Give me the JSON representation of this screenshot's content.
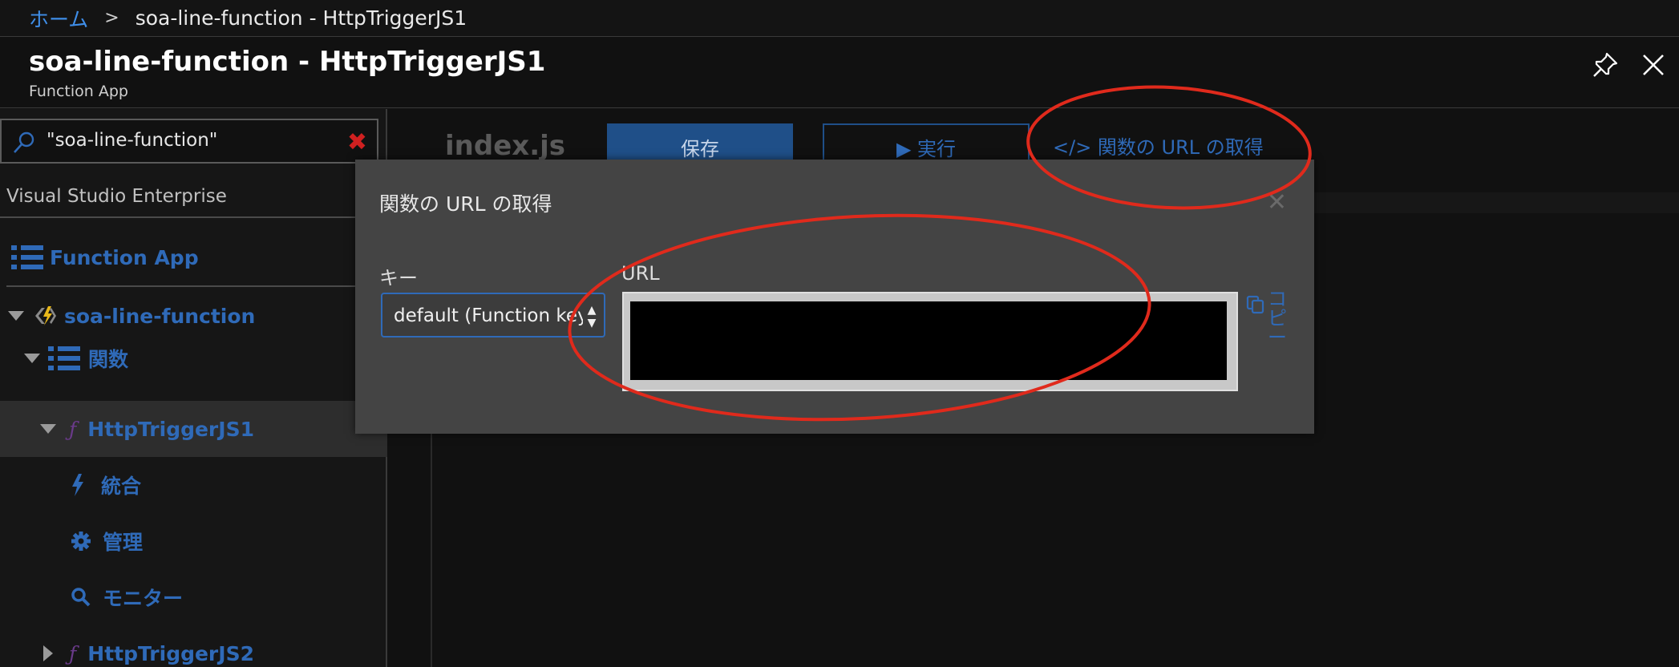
{
  "breadcrumb": {
    "home": "ホーム",
    "separator": ">",
    "current": "soa-line-function - HttpTriggerJS1"
  },
  "header": {
    "title": "soa-line-function - HttpTriggerJS1",
    "subtitle": "Function App",
    "pin_icon": "pin-icon",
    "close_icon": "close-icon"
  },
  "sidebar": {
    "search_value": "\"soa-line-function\"",
    "clear_glyph": "✖",
    "subscription": "Visual Studio Enterprise",
    "subscription_chevron": "˅",
    "function_app_label": "Function App",
    "app_name": "soa-line-function",
    "functions_label": "関数",
    "function_glyph": "ƒ",
    "selected_function": "HttpTriggerJS1",
    "integrate_label": "統合",
    "manage_label": "管理",
    "monitor_label": "モニター",
    "next_function": "HttpTriggerJS2"
  },
  "editor": {
    "file_name": "index.js",
    "save_label": "保存",
    "run_label": "▶ 実行",
    "get_url_label": "</> 関数の URL の取得"
  },
  "dialog": {
    "title": "関数の URL の取得",
    "close_glyph": "✕",
    "key_label": "キー",
    "key_value": "default (Function key)",
    "select_arrows": "▲▼",
    "url_label": "URL",
    "copy_label": "コピー"
  },
  "colors": {
    "accent": "#2f6ab8",
    "annotation": "#e02a1c",
    "dialog_bg": "#444444"
  }
}
